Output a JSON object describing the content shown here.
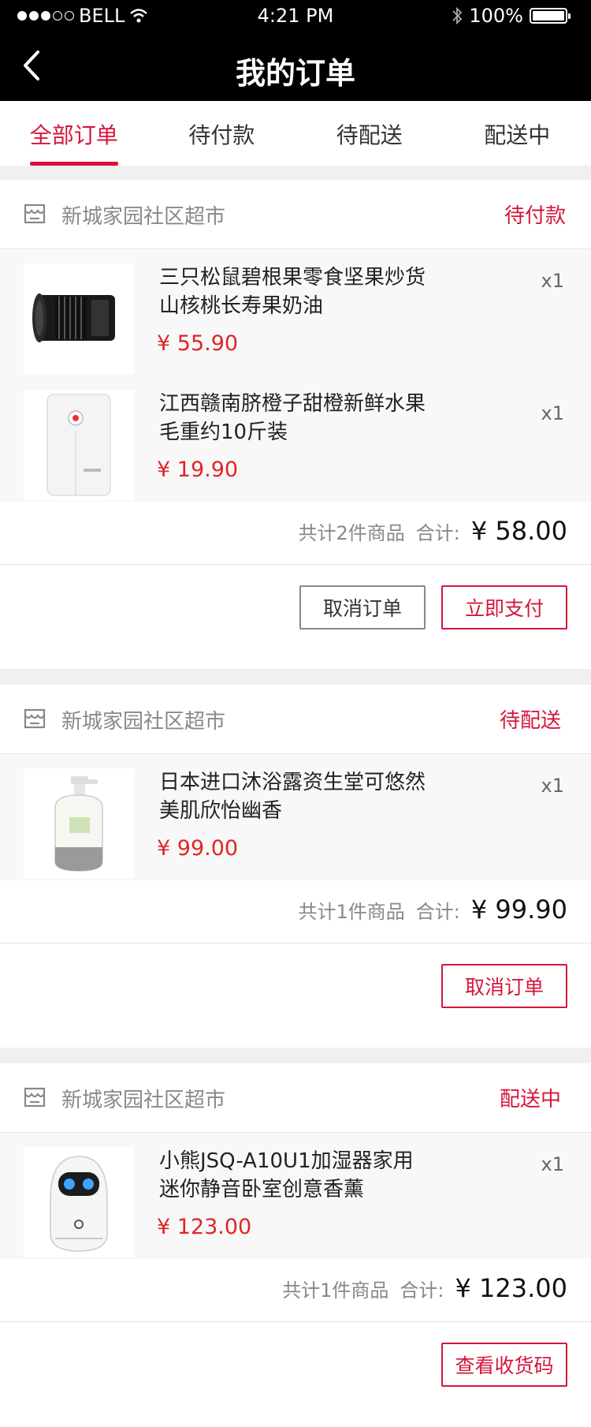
{
  "status_bar": {
    "carrier": "BELL",
    "time": "4:21 PM",
    "battery": "100%"
  },
  "nav": {
    "title": "我的订单"
  },
  "tabs": [
    {
      "label": "全部订单",
      "active": true
    },
    {
      "label": "待付款",
      "active": false
    },
    {
      "label": "待配送",
      "active": false
    },
    {
      "label": "配送中",
      "active": false
    }
  ],
  "orders": [
    {
      "store": "新城家园社区超市",
      "status": "待付款",
      "items": [
        {
          "title_line1": "三只松鼠碧根果零食坚果炒货",
          "title_line2": "山核桃长寿果奶油",
          "price": "¥ 55.90",
          "qty": "x1",
          "image": "camera-lens"
        },
        {
          "title_line1": "江西赣南脐橙子甜橙新鲜水果",
          "title_line2": "毛重约10斤装",
          "price": "¥ 19.90",
          "qty": "x1",
          "image": "white-appliance"
        }
      ],
      "count_text": "共计2件商品",
      "total_label": "合计:",
      "total": "¥ 58.00",
      "buttons": [
        "取消订单",
        "立即支付"
      ]
    },
    {
      "store": "新城家园社区超市",
      "status": "待配送",
      "items": [
        {
          "title_line1": "日本进口沐浴露资生堂可悠然",
          "title_line2": "美肌欣怡幽香",
          "price": "¥ 99.00",
          "qty": "x1",
          "image": "lotion-bottle"
        }
      ],
      "count_text": "共计1件商品",
      "total_label": "合计:",
      "total": "¥ 99.90",
      "buttons": [
        "取消订单"
      ]
    },
    {
      "store": "新城家园社区超市",
      "status": "配送中",
      "items": [
        {
          "title_line1": "小熊JSQ-A10U1加湿器家用",
          "title_line2": "迷你静音卧室创意香薰",
          "price": "¥ 123.00",
          "qty": "x1",
          "image": "robot-humidifier"
        }
      ],
      "count_text": "共计1件商品",
      "total_label": "合计:",
      "total": "¥ 123.00",
      "buttons": [
        "查看收货码"
      ]
    }
  ],
  "colors": {
    "accent": "#d6153b",
    "price": "#e02525",
    "header_bg": "#000000",
    "page_bg": "#f0f0f0"
  }
}
